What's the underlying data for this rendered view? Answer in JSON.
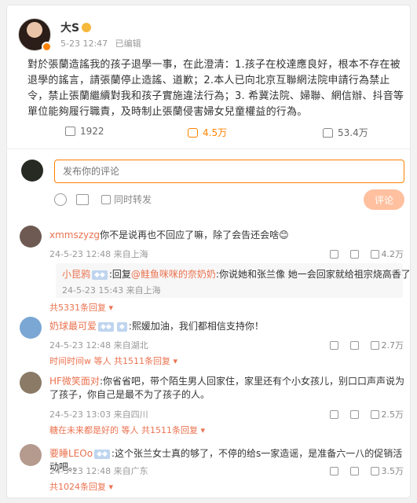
{
  "post": {
    "author": "大S",
    "time": "5-23 12:47",
    "edited": "已编辑",
    "text": "對於張蘭造謠我的孩子退學一事，在此澄清：1.孩子在校達應良好，根本不存在被退學的謠言，請張蘭停止造謠、道歉；2.本人已向北京互聯網法院申請行為禁止令，禁止張蘭繼續對我和孩子實施違法行為；3. 希冀法院、婦聯、網信辦、抖音等單位能夠履行職責，及時制止張蘭侵害婦女兒童權益的行為。",
    "shares": "1922",
    "comments": "4.5万",
    "likes": "53.4万"
  },
  "composer": {
    "placeholder": "发布你的评论",
    "repost_label": "同时转发",
    "submit": "评论"
  },
  "comments": [
    {
      "user": "xmmszyzg",
      "text": "你不是说再也不回应了嘛，除了会告还会啥😊",
      "meta": "24-5-23 12:48 来自上海",
      "likes": "4.2万",
      "avatar_color": "#6e5a52",
      "reply": {
        "user": "小昆鸦",
        "prefix": ":回复",
        "target": "@鲑鱼咪咪的奈奶奶",
        "text": ":你说她和张兰像 她一会回家就给祖宗烧高香了",
        "meta": "24-5-23 15:43 来自上海"
      },
      "more": "共5331条回复 ▾"
    },
    {
      "user": "奶球最可爱",
      "text": ":熙媛加油，我们都相信支持你！",
      "meta": "24-5-23 12:48 来自湖北",
      "likes": "2.7万",
      "avatar_color": "#7aa7d4",
      "extra": "时间时间w 等人",
      "more": "共1511条回复 ▾"
    },
    {
      "user": "HF微笑面对",
      "text": ":你省省吧，带个陌生男人回家住，家里还有个小女孩儿，别口口声声说为了孩子，你自己是最不为了孩子的人。",
      "meta": "24-5-23 13:03 来自四川",
      "likes": "2.5万",
      "avatar_color": "#8a7a66",
      "extra": "糖在未来都是好的 等人",
      "more": "共1511条回复 ▾"
    },
    {
      "user": "要睡LEOo",
      "text": ":这个张兰女士真的够了，不停的给s一家造谣，是准备六一八的促销活动吧。。",
      "meta": "24-5-23 12:48 来自广东",
      "likes": "3.5万",
      "avatar_color": "#b59a8e",
      "more": "共1024条回复 ▾"
    }
  ],
  "colors": {
    "accent": "#ff8200",
    "username": "#eb7350"
  }
}
